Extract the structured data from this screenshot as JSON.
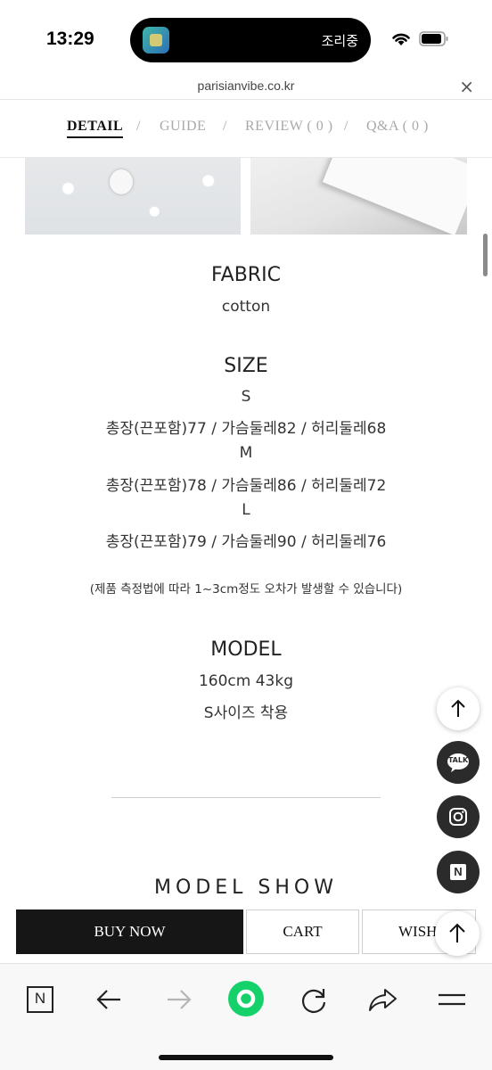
{
  "status": {
    "time": "13:29",
    "island_text": "조리중"
  },
  "url": {
    "domain": "parisianvibe.co.kr",
    "close_symbol": "×"
  },
  "tabs": [
    {
      "label": "DETAIL"
    },
    {
      "label": "GUIDE"
    },
    {
      "label": "REVIEW ( 0 )"
    },
    {
      "label": "Q&A ( 0 )"
    }
  ],
  "tab_separator": "/",
  "detail": {
    "fabric_title": "FABRIC",
    "fabric_value": "cotton",
    "size_title": "SIZE",
    "size_lines": [
      "S",
      "총장(끈포함)77 / 가슴둘레82 / 허리둘레68",
      "M",
      "총장(끈포함)78 / 가슴둘레86 / 허리둘레72",
      "L",
      "총장(끈포함)79 / 가슴둘레90 / 허리둘레76"
    ],
    "size_note": "(제품 측정법에 따라 1~3cm정도 오차가 발생할 수 있습니다)",
    "model_title": "MODEL",
    "model_lines": [
      "160cm 43kg",
      "S사이즈 착용"
    ],
    "model_show": "MODEL SHOW"
  },
  "buttons": {
    "buy_now": "BUY NOW",
    "cart": "CART",
    "wish": "WISH",
    "talk": "TALK",
    "naver": "N"
  },
  "colors": {
    "dark": "#161616",
    "fab_dark": "#2b2b2b",
    "reload_green": "#15d16a"
  },
  "icons": [
    "wifi-icon",
    "battery-icon",
    "close-icon",
    "arrow-up-icon",
    "kakao-talk-icon",
    "instagram-icon",
    "naver-icon",
    "back-arrow-icon",
    "forward-arrow-icon",
    "refresh-icon",
    "share-icon",
    "menu-icon"
  ]
}
